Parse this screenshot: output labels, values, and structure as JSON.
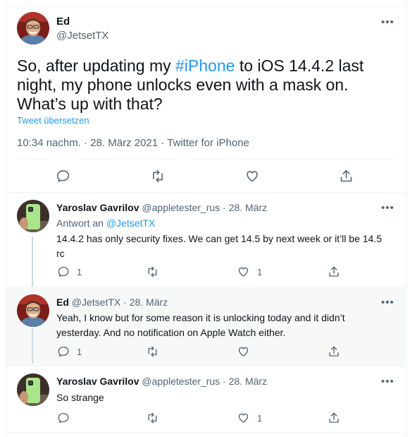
{
  "colors": {
    "accent": "#1d9bf0",
    "secondary": "#536471",
    "text": "#0f1419",
    "border": "#eff3f4",
    "highlight_bg": "#f7f9f9"
  },
  "main_tweet": {
    "name": "Ed",
    "handle": "@JetsetTX",
    "text_before": "So, after updating my ",
    "hashtag": "#iPhone",
    "text_after": " to iOS 14.4.2 last night, my phone unlocks even with a mask on. What’s up with that?",
    "translate_label": "Tweet übersetzen",
    "meta": "10:34 nachm. · 28. März 2021 · Twitter for iPhone",
    "more": "•••",
    "icons": [
      "reply-icon",
      "retweet-icon",
      "like-icon",
      "share-icon"
    ]
  },
  "replies": [
    {
      "name": "Yaroslav Gavrilov",
      "handle": "@appletester_rus",
      "sep": "·",
      "date": "28. März",
      "reply_to_label": "Antwort an",
      "reply_to_handle": "@JetsetTX",
      "text": "14.4.2 has only security fixes. We can get 14.5 by next week or it’ll be 14.5 rc",
      "reply_count": "1",
      "retweet_count": "",
      "like_count": "1",
      "more": "•••"
    },
    {
      "name": "Ed",
      "handle": "@JetsetTX",
      "sep": "·",
      "date": "28. März",
      "text": "Yeah, I know but for some reason it is unlocking today and it didn’t yesterday. And no notification on Apple Watch either.",
      "reply_count": "1",
      "retweet_count": "",
      "like_count": "",
      "more": "•••"
    },
    {
      "name": "Yaroslav Gavrilov",
      "handle": "@appletester_rus",
      "sep": "·",
      "date": "28. März",
      "text": "So strange",
      "reply_count": "",
      "retweet_count": "",
      "like_count": "1",
      "more": "•••"
    }
  ]
}
